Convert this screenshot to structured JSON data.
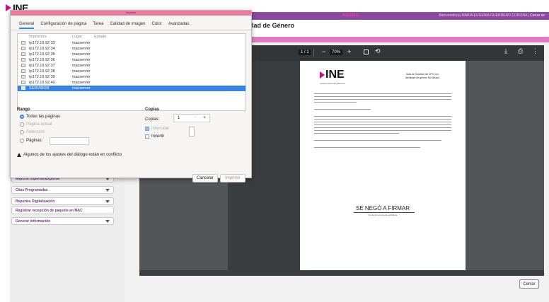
{
  "site": {
    "logo_text": "INE",
    "topbar_center": "ALERTAS",
    "topbar_greeting": "Bienvenido(a) MARIA EUGENIA GUERRERO CORONA",
    "topbar_logout": "Cerrar se",
    "page_heading": "lad de Género",
    "close_button": "Cerrar",
    "brand_color": "#8a4a9e",
    "accent_color": "#c0127a"
  },
  "sidebar": {
    "items": [
      {
        "label": "Reporte importar/Exportar",
        "has_caret": true
      },
      {
        "label": "Citas Programadas",
        "has_caret": true
      },
      {
        "label": "Reportes Digitalización",
        "has_caret": true
      },
      {
        "label": "Registrar recepción de paquete en MAC",
        "has_caret": false
      },
      {
        "label": "Generar información",
        "has_caret": true
      }
    ]
  },
  "pdf_viewer": {
    "page_indicator": "1 / 1",
    "zoom": "70%",
    "icons": [
      "fit-page-icon",
      "rotate-icon",
      "download-icon",
      "print-icon",
      "more-icon"
    ],
    "document": {
      "logo_text": "INE",
      "logo_sub": "Instituto Nacional Electoral",
      "title_line1": "Acta de Solicitud de CPV con",
      "title_line2": "Identidad de género No Binario",
      "signature_text": "SE NEGÓ A FIRMAR",
      "signature_caption": "Firma de la persona solicitante"
    }
  },
  "print_dialog": {
    "title": "Imprimir",
    "tabs": [
      "General",
      "Configuración de página",
      "Tarea",
      "Calidad de imagen",
      "Color",
      "Avanzadas"
    ],
    "active_tab": "General",
    "columns": {
      "printer": "Impresora",
      "location": "Lugar",
      "status": "Estado"
    },
    "printers": [
      {
        "name": "Ip172.19.92.33",
        "location": "macserver"
      },
      {
        "name": "Ip172.19.92.34",
        "location": "macserver"
      },
      {
        "name": "Ip172.19.92.35",
        "location": "macserver"
      },
      {
        "name": "Ip172.19.92.36",
        "location": "macserver"
      },
      {
        "name": "Ip172.19.92.37",
        "location": "macserver"
      },
      {
        "name": "Ip172.19.92.38",
        "location": "macserver"
      },
      {
        "name": "Ip172.19.92.39",
        "location": "macserver"
      },
      {
        "name": "Ip172.19.92.40",
        "location": "macserver"
      },
      {
        "name": "SERVIDOR",
        "location": "macserver"
      }
    ],
    "selected_printer": "SERVIDOR",
    "range": {
      "title": "Rango",
      "all_pages": "Todas las páginas",
      "current_page": "Página actual",
      "selection": "Selección",
      "pages": "Páginas:"
    },
    "copies": {
      "title": "Copias",
      "label": "Copias:",
      "value": "1",
      "collate": "Intercalar",
      "reverse": "Invertir"
    },
    "warning": "Algunos de los ajustes del diálogo están en conflicto",
    "cancel_label": "Cancelar",
    "print_label": "Imprimir",
    "selection_color": "#3584e4"
  }
}
